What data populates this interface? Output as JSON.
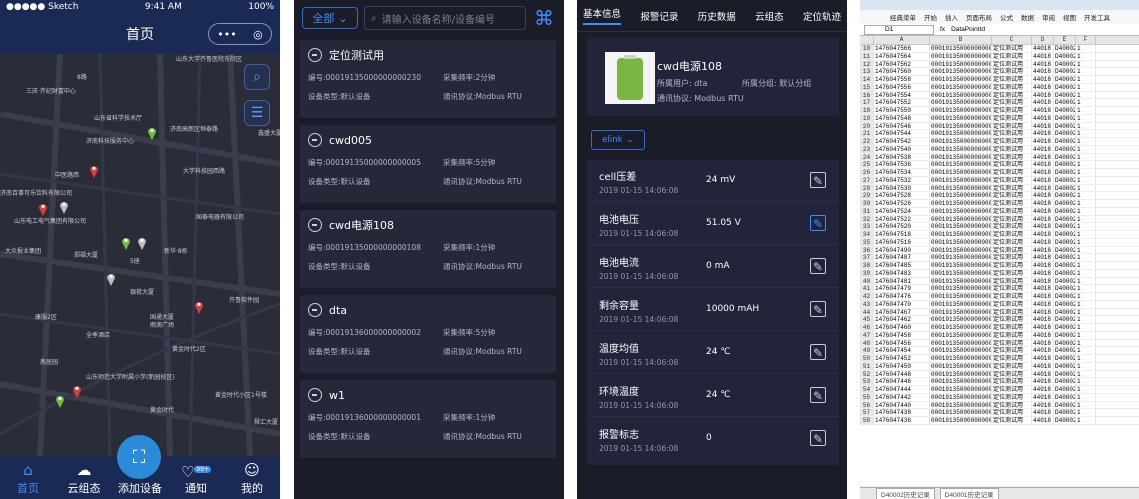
{
  "phone_status": {
    "carrier": "●●●●● Sketch",
    "time": "9:41 AM",
    "battery": "100%"
  },
  "home": {
    "title": "首页",
    "capsule": [
      "•••",
      "◎"
    ],
    "map_labels": [
      "山东大学齐鲁医院东院区",
      "三庆·齐纪财富中心",
      "8路",
      "山东省科学技术厅",
      "济南高新区恒泰路",
      "济南科技服务中心",
      "鑫盛大厦",
      "中医路西",
      "大学科技园西路",
      "济南百事可乐饮料有限公司",
      "山东电工电气集团有限公司",
      "国泰电器有限公司",
      "大众报业集团",
      "郑福大厦",
      "新华·8栋",
      "5座",
      "银荷大厦",
      "齐鲁软件园",
      "国通大厦",
      "康服2区",
      "全季酒店",
      "雨滴广场",
      "黄金时代2区",
      "山东师范大学附属小学(新园校区)",
      "黄金时代",
      "黄金时代小区1号楼",
      "舜汇大厦",
      "燕居园"
    ],
    "tabs": [
      {
        "label": "首页",
        "icon": "home-icon"
      },
      {
        "label": "云组态",
        "icon": "cloud-icon"
      },
      {
        "label": "添加设备",
        "icon": "scan-icon"
      },
      {
        "label": "通知",
        "icon": "bell-icon",
        "badge": "99+"
      },
      {
        "label": "我的",
        "icon": "user-icon"
      }
    ]
  },
  "device_list": {
    "filter": "全部",
    "search_placeholder": "请输入设备名称/设备编号",
    "devices": [
      {
        "name": "定位测试用",
        "id": "编号:00019135000000000230",
        "freq": "采集频率:2分钟",
        "type": "设备类型:默认设备",
        "protocol": "通讯协议:Modbus RTU"
      },
      {
        "name": "cwd005",
        "id": "编号:00019135000000000005",
        "freq": "采集频率:5分钟",
        "type": "设备类型:默认设备",
        "protocol": "通讯协议:Modbus RTU"
      },
      {
        "name": "cwd电源108",
        "id": "编号:00019135000000000108",
        "freq": "采集频率:1分钟",
        "type": "设备类型:默认设备",
        "protocol": "通讯协议:Modbus RTU"
      },
      {
        "name": "dta",
        "id": "编号:00019136000000000002",
        "freq": "采集频率:5分钟",
        "type": "设备类型:默认设备",
        "protocol": "通讯协议:Modbus RTU"
      },
      {
        "name": "w1",
        "id": "编号:00019136000000000001",
        "freq": "采集频率:1分钟",
        "type": "设备类型:默认设备",
        "protocol": "通讯协议:Modbus RTU"
      }
    ]
  },
  "detail": {
    "tabs": [
      "基本信息",
      "报警记录",
      "历史数据",
      "云组态",
      "定位轨迹"
    ],
    "device_name": "cwd电源108",
    "owner": "所属用户:  dta",
    "group": "所属分组:  默认分组",
    "protocol": "通讯协议:  Modbus RTU",
    "gateway": "elink",
    "readings": [
      {
        "name": "cell压差",
        "time": "2019 01-15 14:06:08",
        "value": "24 mV"
      },
      {
        "name": "电池电压",
        "time": "2019 01-15 14:06:08",
        "value": "51.05 V"
      },
      {
        "name": "电池电流",
        "time": "2019 01-15 14:06:08",
        "value": "0 mA"
      },
      {
        "name": "剩余容量",
        "time": "2019 01-15 14:06:08",
        "value": "10000 mAH"
      },
      {
        "name": "温度均值",
        "time": "2019 01-15 14:06:08",
        "value": "24 ℃"
      },
      {
        "name": "环境温度",
        "time": "2019 01-15 14:06:08",
        "value": "24 ℃"
      },
      {
        "name": "报警标志",
        "time": "2019 01-15 14:06:08",
        "value": "0"
      }
    ]
  },
  "spreadsheet": {
    "menu": [
      "经典菜单",
      "开始",
      "插入",
      "页面布局",
      "公式",
      "数据",
      "审阅",
      "视图",
      "开发工具"
    ],
    "cell_ref": "D1",
    "formula": "DataPointId",
    "columns": [
      "A",
      "B",
      "C",
      "D",
      "E",
      "F"
    ],
    "sheet_tabs": [
      "D40002历史记录",
      "D40001历史记录"
    ],
    "rows": [
      [
        "10",
        "1476047566",
        "00019135000000000230",
        "定位测试用",
        "44018",
        "D40002",
        "1"
      ],
      [
        "11",
        "1476047564",
        "00019135000000000230",
        "定位测试用",
        "44018",
        "D40002",
        "1"
      ],
      [
        "12",
        "1476047562",
        "00019135000000000230",
        "定位测试用",
        "44018",
        "D40002",
        "1"
      ],
      [
        "13",
        "1476047560",
        "00019135000000000230",
        "定位测试用",
        "44018",
        "D40002",
        "1"
      ],
      [
        "14",
        "1476047558",
        "00019135000000000230",
        "定位测试用",
        "44018",
        "D40002",
        "1"
      ],
      [
        "15",
        "1476047556",
        "00019135000000000230",
        "定位测试用",
        "44018",
        "D40002",
        "1"
      ],
      [
        "16",
        "1476047554",
        "00019135000000000230",
        "定位测试用",
        "44018",
        "D40002",
        "1"
      ],
      [
        "17",
        "1476047552",
        "00019135000000000230",
        "定位测试用",
        "44018",
        "D40002",
        "1"
      ],
      [
        "18",
        "1476047550",
        "00019135000000000230",
        "定位测试用",
        "44018",
        "D40002",
        "1"
      ],
      [
        "19",
        "1476047548",
        "00019135000000000230",
        "定位测试用",
        "44018",
        "D40002",
        "1"
      ],
      [
        "20",
        "1476047546",
        "00019135000000000230",
        "定位测试用",
        "44018",
        "D40002",
        "1"
      ],
      [
        "21",
        "1476047544",
        "00019135000000000230",
        "定位测试用",
        "44018",
        "D40002",
        "1"
      ],
      [
        "22",
        "1476047542",
        "00019135000000000230",
        "定位测试用",
        "44018",
        "D40002",
        "1"
      ],
      [
        "23",
        "1476047540",
        "00019135000000000230",
        "定位测试用",
        "44018",
        "D40002",
        "1"
      ],
      [
        "24",
        "1476047538",
        "00019135000000000230",
        "定位测试用",
        "44018",
        "D40002",
        "1"
      ],
      [
        "25",
        "1476047536",
        "00019135000000000230",
        "定位测试用",
        "44018",
        "D40002",
        "1"
      ],
      [
        "26",
        "1476047534",
        "00019135000000000230",
        "定位测试用",
        "44018",
        "D40002",
        "1"
      ],
      [
        "27",
        "1476047532",
        "00019135000000000230",
        "定位测试用",
        "44018",
        "D40002",
        "1"
      ],
      [
        "28",
        "1476047530",
        "00019135000000000230",
        "定位测试用",
        "44018",
        "D40002",
        "1"
      ],
      [
        "29",
        "1476047528",
        "00019135000000000230",
        "定位测试用",
        "44018",
        "D40002",
        "1"
      ],
      [
        "30",
        "1476047526",
        "00019135000000000230",
        "定位测试用",
        "44018",
        "D40002",
        "1"
      ],
      [
        "31",
        "1476047524",
        "00019135000000000230",
        "定位测试用",
        "44018",
        "D40002",
        "1"
      ],
      [
        "32",
        "1476047522",
        "00019135000000000230",
        "定位测试用",
        "44018",
        "D40002",
        "1"
      ],
      [
        "33",
        "1476047520",
        "00019135000000000230",
        "定位测试用",
        "44018",
        "D40002",
        "1"
      ],
      [
        "34",
        "1476047518",
        "00019135000000000230",
        "定位测试用",
        "44018",
        "D40002",
        "1"
      ],
      [
        "35",
        "1476047516",
        "00019135000000000230",
        "定位测试用",
        "44018",
        "D40002",
        "1"
      ],
      [
        "36",
        "1476047490",
        "00019135000000000230",
        "定位测试用",
        "44018",
        "D40002",
        "1"
      ],
      [
        "37",
        "1476047487",
        "00019135000000000230",
        "定位测试用",
        "44018",
        "D40002",
        "1"
      ],
      [
        "38",
        "1476047485",
        "00019135000000000230",
        "定位测试用",
        "44018",
        "D40002",
        "1"
      ],
      [
        "39",
        "1476047483",
        "00019135000000000230",
        "定位测试用",
        "44018",
        "D40002",
        "1"
      ],
      [
        "40",
        "1476047481",
        "00019135000000000230",
        "定位测试用",
        "44018",
        "D40002",
        "1"
      ],
      [
        "41",
        "1476047479",
        "00019135000000000230",
        "定位测试用",
        "44018",
        "D40002",
        "1"
      ],
      [
        "42",
        "1476047476",
        "00019135000000000230",
        "定位测试用",
        "44018",
        "D40002",
        "1"
      ],
      [
        "43",
        "1476047470",
        "00019135000000000230",
        "定位测试用",
        "44018",
        "D40002",
        "1"
      ],
      [
        "44",
        "1476047467",
        "00019135000000000230",
        "定位测试用",
        "44018",
        "D40002",
        "1"
      ],
      [
        "45",
        "1476047462",
        "00019135000000000230",
        "定位测试用",
        "44018",
        "D40002",
        "1"
      ],
      [
        "46",
        "1476047460",
        "00019135000000000230",
        "定位测试用",
        "44018",
        "D40002",
        "1"
      ],
      [
        "47",
        "1476047458",
        "00019135000000000230",
        "定位测试用",
        "44018",
        "D40002",
        "1"
      ],
      [
        "48",
        "1476047456",
        "00019135000000000230",
        "定位测试用",
        "44018",
        "D40002",
        "1"
      ],
      [
        "49",
        "1476047454",
        "00019135000000000230",
        "定位测试用",
        "44018",
        "D40002",
        "1"
      ],
      [
        "50",
        "1476047452",
        "00019135000000000230",
        "定位测试用",
        "44018",
        "D40002",
        "1"
      ],
      [
        "51",
        "1476047450",
        "00019135000000000230",
        "定位测试用",
        "44018",
        "D40002",
        "1"
      ],
      [
        "52",
        "1476047448",
        "00019135000000000230",
        "定位测试用",
        "44018",
        "D40002",
        "1"
      ],
      [
        "53",
        "1476047446",
        "00019135000000000230",
        "定位测试用",
        "44018",
        "D40002",
        "1"
      ],
      [
        "54",
        "1476047444",
        "00019135000000000230",
        "定位测试用",
        "44018",
        "D40002",
        "1"
      ],
      [
        "55",
        "1476047442",
        "00019135000000000230",
        "定位测试用",
        "44018",
        "D40002",
        "1"
      ],
      [
        "56",
        "1476047440",
        "00019135000000000230",
        "定位测试用",
        "44018",
        "D40002",
        "1"
      ],
      [
        "57",
        "1476047438",
        "00019135000000000230",
        "定位测试用",
        "44018",
        "D40002",
        "1"
      ],
      [
        "58",
        "1476047436",
        "00019135000000000230",
        "定位测试用",
        "44018",
        "D40002",
        "1"
      ]
    ]
  }
}
